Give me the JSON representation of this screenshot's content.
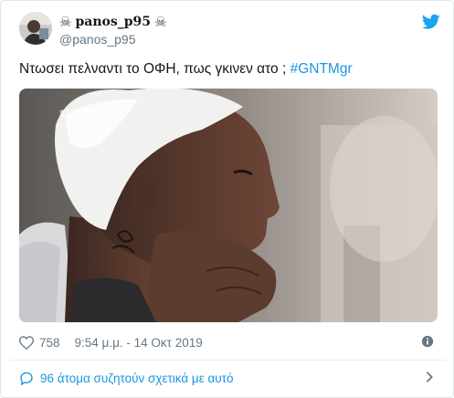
{
  "tweet": {
    "display_name": "panos_p95",
    "name_decoration_left": "☠",
    "name_decoration_right": "☠",
    "handle": "@panos_p95",
    "text": "Ντωσει πελναντι το ΟΦΗ, πως γκινεν ατο ; ",
    "hashtag": "#GNTMgr",
    "media_watermark": "starHD",
    "likes": "758",
    "timestamp": "9:54 μ.μ. - 14 Οκτ 2019",
    "conversation_link": "96 άτομα συζητούν σχετικά με αυτό"
  },
  "colors": {
    "link": "#1b95e0",
    "secondary_text": "#657786",
    "twitter_blue": "#1da1f2"
  },
  "icons": [
    "twitter-logo-icon",
    "heart-icon",
    "info-icon",
    "speech-bubble-icon",
    "chevron-right-icon"
  ]
}
